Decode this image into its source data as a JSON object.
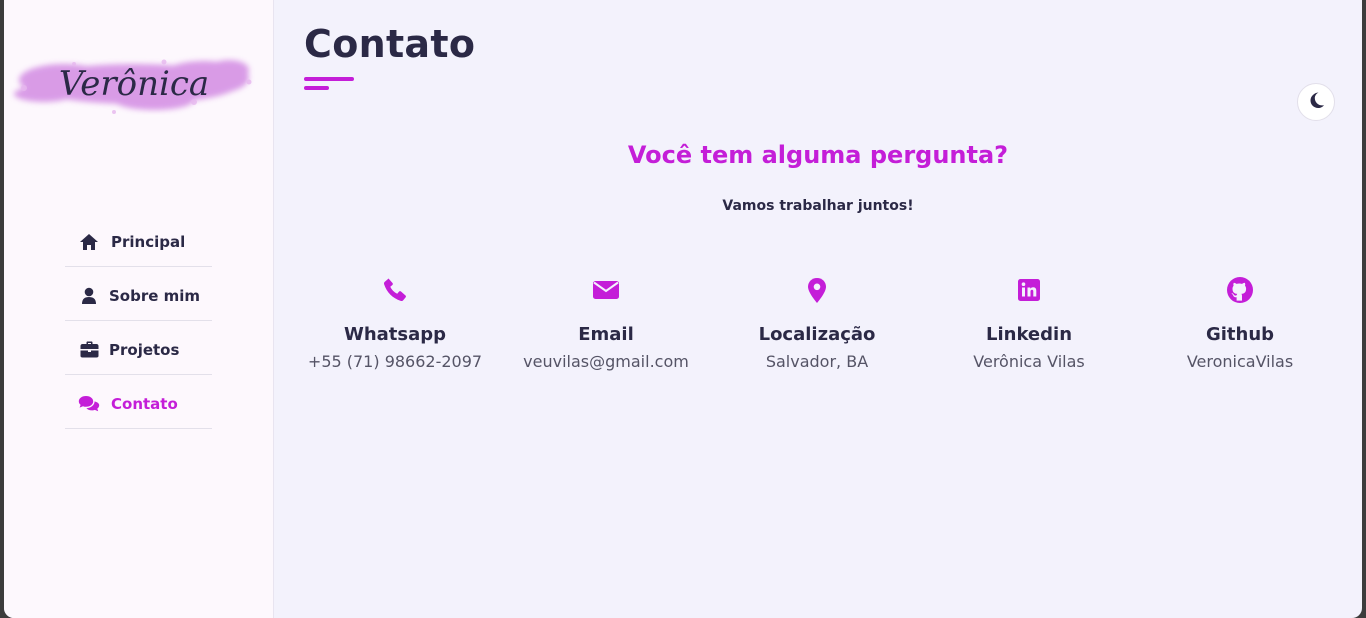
{
  "logo": {
    "text": "Verônica"
  },
  "nav": {
    "items": [
      {
        "label": "Principal",
        "icon": "home-icon"
      },
      {
        "label": "Sobre mim",
        "icon": "user-icon"
      },
      {
        "label": "Projetos",
        "icon": "briefcase-icon"
      },
      {
        "label": "Contato",
        "icon": "comments-icon"
      }
    ],
    "active": "Contato"
  },
  "page": {
    "title": "Contato",
    "question": "Você tem alguma pergunta?",
    "subtitle": "Vamos trabalhar juntos!"
  },
  "theme_toggle": {
    "icon": "moon-icon"
  },
  "contacts": [
    {
      "label": "Whatsapp",
      "value": "+55 (71) 98662-2097",
      "icon": "phone-icon"
    },
    {
      "label": "Email",
      "value": "veuvilas@gmail.com",
      "icon": "envelope-icon"
    },
    {
      "label": "Localização",
      "value": "Salvador, BA",
      "icon": "map-pin-icon"
    },
    {
      "label": "Linkedin",
      "value": "Verônica Vilas",
      "icon": "linkedin-icon"
    },
    {
      "label": "Github",
      "value": "VeronicaVilas",
      "icon": "github-icon"
    }
  ],
  "colors": {
    "accent": "#c41ed8",
    "text": "#2b2946",
    "background": "#f3f2fc",
    "sidebar": "#fdf8fd"
  }
}
